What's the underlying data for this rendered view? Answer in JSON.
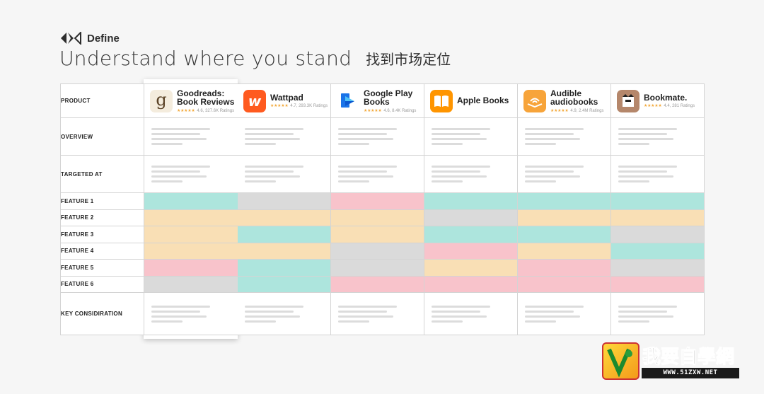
{
  "brand": {
    "name": "Define"
  },
  "headline": {
    "title": "Understand where you stand",
    "subtitle_cn": "找到市场定位"
  },
  "row_labels": {
    "product": "PRODUCT",
    "overview": "OVERVIEW",
    "targeted_at": "TARGETED AT",
    "features": [
      "FEATURE 1",
      "FEATURE 2",
      "FEATURE 3",
      "FEATURE 4",
      "FEATURE 5",
      "FEATURE 6"
    ],
    "key": "KEY CONSIDIRATION"
  },
  "apps": [
    {
      "name": "Goodreads: Book Reviews",
      "stars": "★★★★★",
      "rating": "4.6, 327.6K Ratings",
      "icon": "goodreads-g-icon",
      "icon_bg": "#f4ecdd",
      "icon_fg": "#5b4327"
    },
    {
      "name": "Wattpad",
      "stars": "★★★★★",
      "rating": "4.7, 293.3K Ratings",
      "icon": "wattpad-w-icon",
      "icon_bg": "#ff5a1f",
      "icon_fg": "#ffffff"
    },
    {
      "name": "Google Play Books",
      "stars": "★★★★★",
      "rating": "4.6, 8.4K Ratings",
      "icon": "google-play-books-icon",
      "icon_bg": "#ffffff",
      "icon_fg": "#1a73e8"
    },
    {
      "name": "Apple Books",
      "stars": "★★★★★",
      "rating": "",
      "icon": "apple-books-icon",
      "icon_bg": "#ff9500",
      "icon_fg": "#ffffff"
    },
    {
      "name": "Audible audiobooks",
      "stars": "★★★★★",
      "rating": "4.9, 2.4M Ratings",
      "icon": "audible-icon",
      "icon_bg": "#f7a43a",
      "icon_fg": "#ffffff"
    },
    {
      "name": "Bookmate.",
      "stars": "★★★★★",
      "rating": "4.4, 281 Ratings",
      "icon": "bookmate-icon",
      "icon_bg": "#b5876b",
      "icon_fg": "#222222"
    }
  ],
  "feature_colors": {
    "teal": "#ade5dd",
    "gray": "#dadada",
    "pink": "#f8c3cb",
    "peach": "#f9dfb5"
  },
  "feature_matrix": [
    [
      "teal",
      "gray",
      "pink",
      "teal",
      "teal",
      "teal"
    ],
    [
      "peach",
      "peach",
      "peach",
      "gray",
      "peach",
      "peach"
    ],
    [
      "peach",
      "teal",
      "peach",
      "teal",
      "teal",
      "gray"
    ],
    [
      "peach",
      "peach",
      "gray",
      "pink",
      "peach",
      "teal"
    ],
    [
      "pink",
      "teal",
      "gray",
      "peach",
      "pink",
      "gray"
    ],
    [
      "gray",
      "teal",
      "pink",
      "pink",
      "pink",
      "pink"
    ]
  ],
  "watermark": {
    "title": "我要自學網",
    "url": "WWW.51ZXW.NET"
  }
}
